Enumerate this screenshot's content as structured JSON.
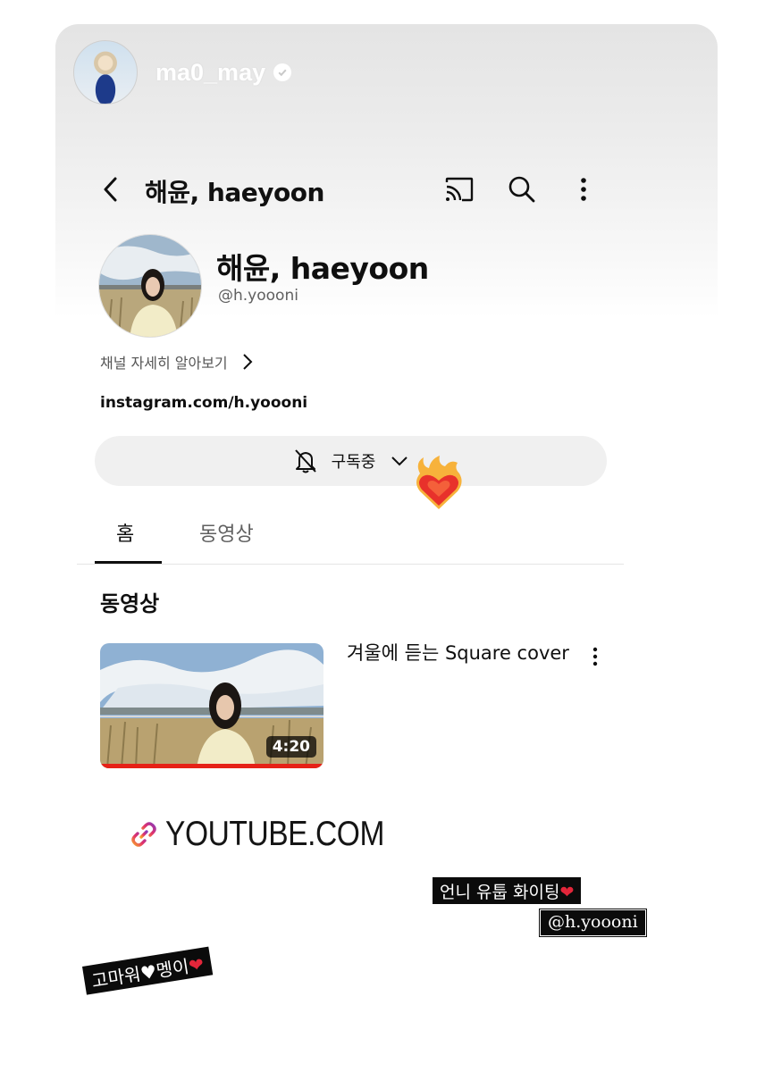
{
  "story": {
    "username": "ma0_may",
    "verified": true
  },
  "appbar": {
    "title": "해윤, haeyoon",
    "icons": [
      "back-icon",
      "cast-icon",
      "search-icon",
      "more-icon"
    ]
  },
  "channel": {
    "name": "해윤, haeyoon",
    "handle": "@h.yoooni",
    "more_label": "채널 자세히 알아보기",
    "link": "instagram.com/h.yoooni"
  },
  "subscribe": {
    "label": "구독중"
  },
  "tabs": [
    {
      "label": "홈",
      "selected": true
    },
    {
      "label": "동영상",
      "selected": false
    }
  ],
  "section": {
    "title": "동영상"
  },
  "video": {
    "title": "겨울에 듣는 Square cover",
    "duration": "4:20"
  },
  "link_sticker": {
    "text": "YOUTUBE.COM"
  },
  "captions": {
    "cheer_text": "언니 유툽 화이팅",
    "cheer_heart": "❤",
    "mention": "@h.yoooni",
    "thanks_a": "고마워",
    "thanks_heart_white": "♥",
    "thanks_b": "멩이",
    "thanks_heart_red": "❤"
  },
  "colors": {
    "accent_red": "#e62117",
    "caption_bg": "#0b0b0b"
  }
}
